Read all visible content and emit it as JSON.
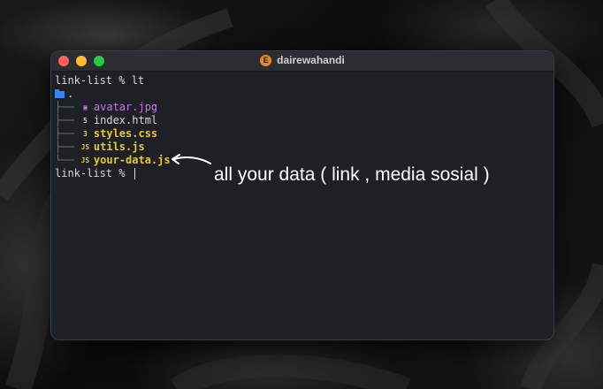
{
  "window": {
    "title": "dairewahandi",
    "title_icon_letter": "E"
  },
  "terminal": {
    "prompt_1": "link-list % ",
    "command": "lt",
    "root": ".",
    "files": [
      {
        "tree": "├── ",
        "icon": "▣",
        "name": "avatar.jpg",
        "kind": "jpg"
      },
      {
        "tree": "├── ",
        "icon": "5",
        "name": "index.html",
        "kind": "html"
      },
      {
        "tree": "├── ",
        "icon": "3",
        "name": "styles.css",
        "kind": "css"
      },
      {
        "tree": "├── ",
        "icon": "JS",
        "name": "utils.js",
        "kind": "js"
      },
      {
        "tree": "└── ",
        "icon": "JS",
        "name": "your-data.js",
        "kind": "js"
      }
    ],
    "prompt_2": "link-list % "
  },
  "annotation": {
    "text": "all your data ( link , media sosial )"
  },
  "colors": {
    "close": "#ff5f57",
    "minimize": "#febc2e",
    "maximize": "#28c840",
    "folder": "#3b82f6",
    "js": "#e5c540",
    "jpg": "#c678dd"
  }
}
